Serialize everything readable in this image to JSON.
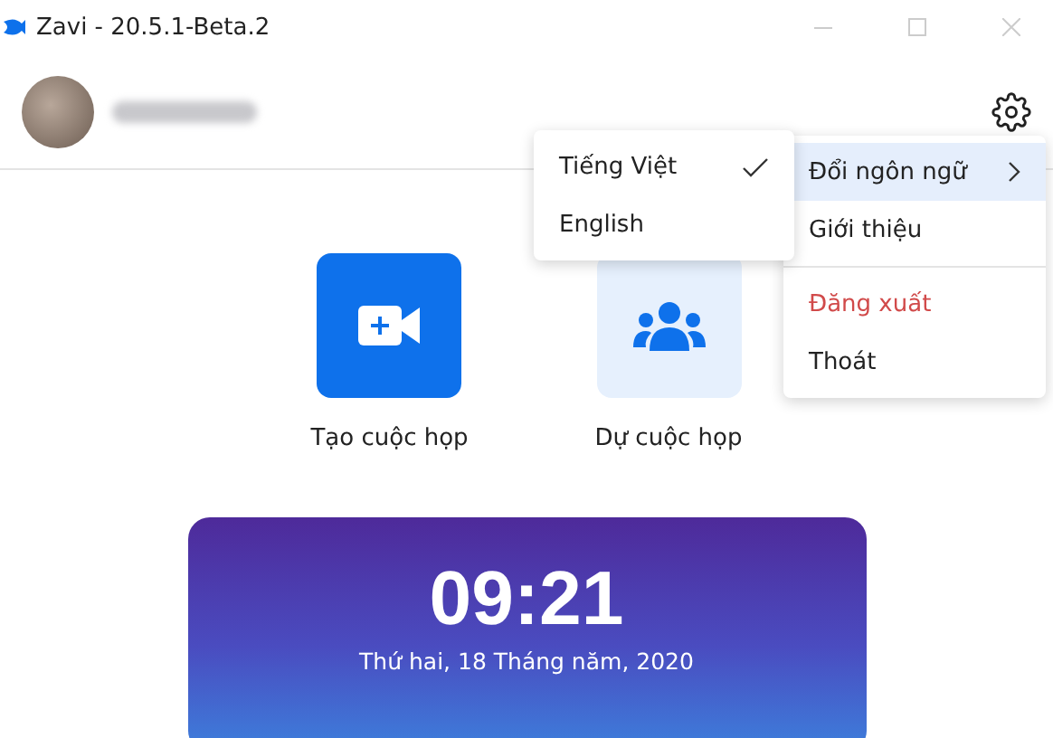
{
  "window": {
    "title": "Zavi - 20.5.1-Beta.2"
  },
  "actions": [
    {
      "label": "Tạo cuộc họp",
      "kind": "primary"
    },
    {
      "label": "Dự cuộc họp",
      "kind": "secondary"
    }
  ],
  "clock": {
    "time": "09:21",
    "date": "Thứ hai, 18 Tháng năm, 2020"
  },
  "settings_menu": {
    "items": [
      {
        "label": "Đổi ngôn ngữ",
        "kind": "submenu",
        "selected": true
      },
      {
        "label": "Giới thiệu",
        "kind": "normal",
        "selected": false
      },
      {
        "label": "Đăng xuất",
        "kind": "danger",
        "selected": false
      },
      {
        "label": "Thoát",
        "kind": "normal",
        "selected": false
      }
    ]
  },
  "language_menu": {
    "items": [
      {
        "label": "Tiếng Việt",
        "checked": true
      },
      {
        "label": "English",
        "checked": false
      }
    ]
  }
}
